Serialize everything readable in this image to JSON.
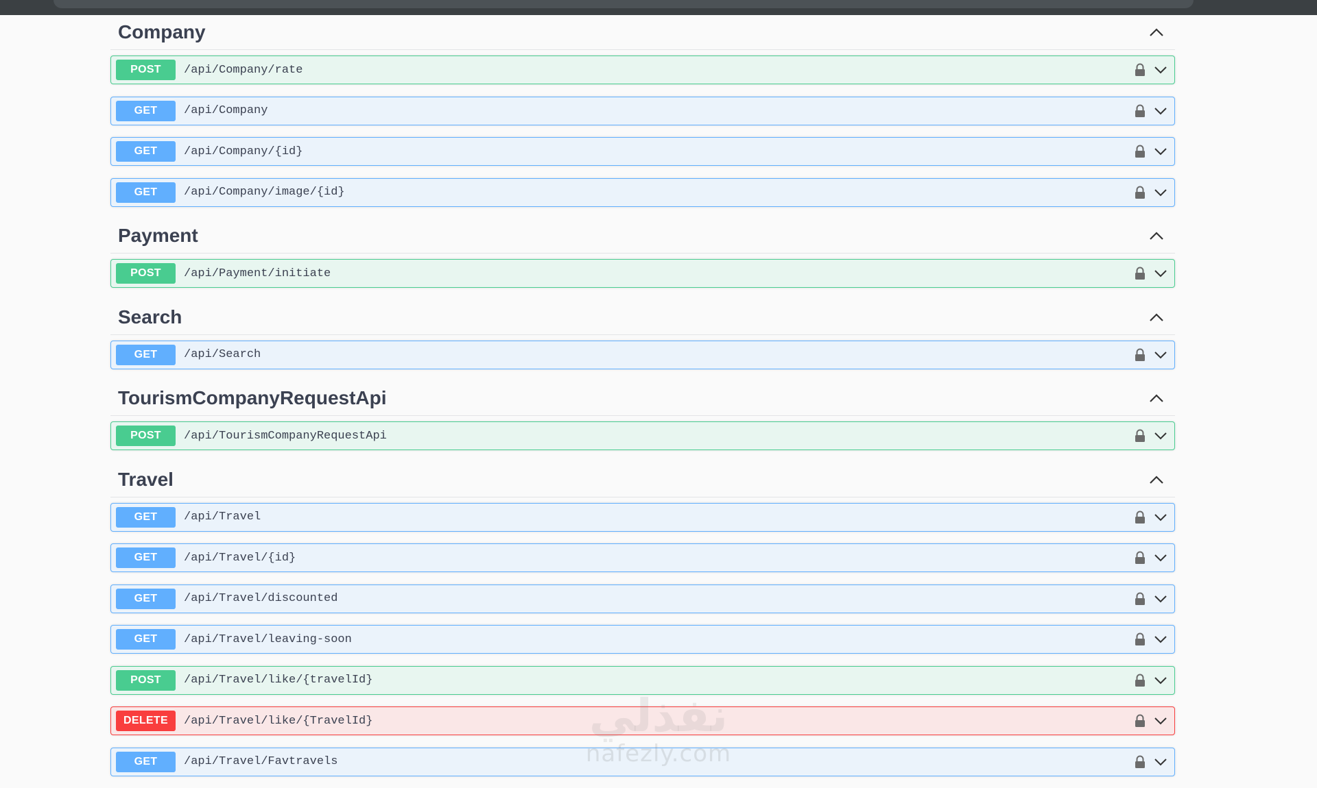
{
  "sections": {
    "company": {
      "title": "Company",
      "ops": [
        {
          "method": "POST",
          "path": "/api/Company/rate"
        },
        {
          "method": "GET",
          "path": "/api/Company"
        },
        {
          "method": "GET",
          "path": "/api/Company/{id}"
        },
        {
          "method": "GET",
          "path": "/api/Company/image/{id}"
        }
      ]
    },
    "payment": {
      "title": "Payment",
      "ops": [
        {
          "method": "POST",
          "path": "/api/Payment/initiate"
        }
      ]
    },
    "search": {
      "title": "Search",
      "ops": [
        {
          "method": "GET",
          "path": "/api/Search"
        }
      ]
    },
    "tourism": {
      "title": "TourismCompanyRequestApi",
      "ops": [
        {
          "method": "POST",
          "path": "/api/TourismCompanyRequestApi"
        }
      ]
    },
    "travel": {
      "title": "Travel",
      "ops": [
        {
          "method": "GET",
          "path": "/api/Travel"
        },
        {
          "method": "GET",
          "path": "/api/Travel/{id}"
        },
        {
          "method": "GET",
          "path": "/api/Travel/discounted"
        },
        {
          "method": "GET",
          "path": "/api/Travel/leaving-soon"
        },
        {
          "method": "POST",
          "path": "/api/Travel/like/{travelId}"
        },
        {
          "method": "DELETE",
          "path": "/api/Travel/like/{TravelId}"
        },
        {
          "method": "GET",
          "path": "/api/Travel/Favtravels"
        }
      ]
    }
  },
  "watermark": {
    "arabic": "نفذلي",
    "latin": "nafezly.com"
  },
  "colors": {
    "get": "#61affe",
    "post": "#49cc90",
    "delete": "#f93e3e"
  },
  "icons": {
    "section_toggle": "chevron-up-icon",
    "op_lock": "lock-icon",
    "op_expand": "chevron-down-icon"
  }
}
